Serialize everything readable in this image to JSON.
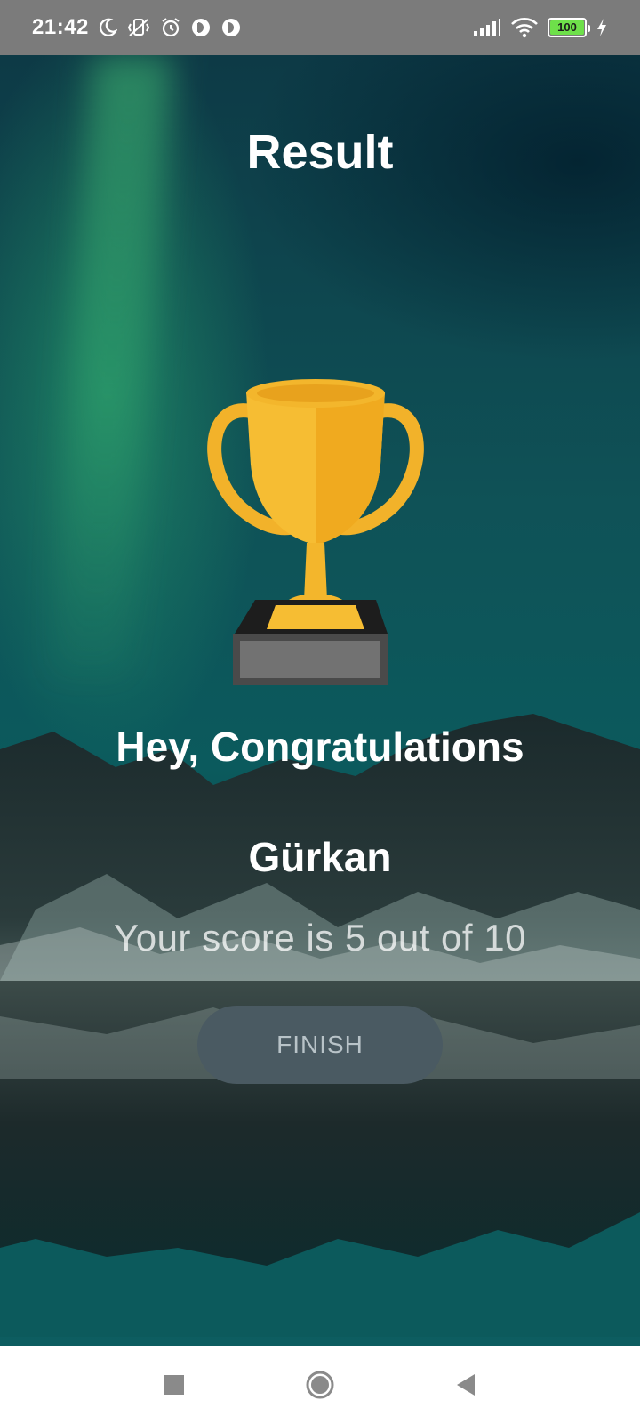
{
  "status_bar": {
    "time": "21:42",
    "battery_level": "100",
    "icons": [
      "moon-icon",
      "vibrate-off-icon",
      "alarm-icon",
      "app-icon-1",
      "app-icon-2",
      "signal-icon",
      "wifi-icon",
      "battery-icon",
      "charging-icon"
    ]
  },
  "screen": {
    "title": "Result",
    "congratulations": "Hey, Congratulations",
    "username": "Gürkan",
    "score_text": "Your score is 5 out of 10",
    "finish_label": "FINISH"
  },
  "nav_bar": {
    "icons": [
      "recents-square-icon",
      "home-circle-icon",
      "back-triangle-icon"
    ]
  },
  "colors": {
    "status_bar_bg": "#7b7b7b",
    "trophy_gold": "#f4b72a",
    "button_bg": "#4a5a62",
    "button_text": "#b8c3c8",
    "battery_green": "#6ee04a"
  }
}
